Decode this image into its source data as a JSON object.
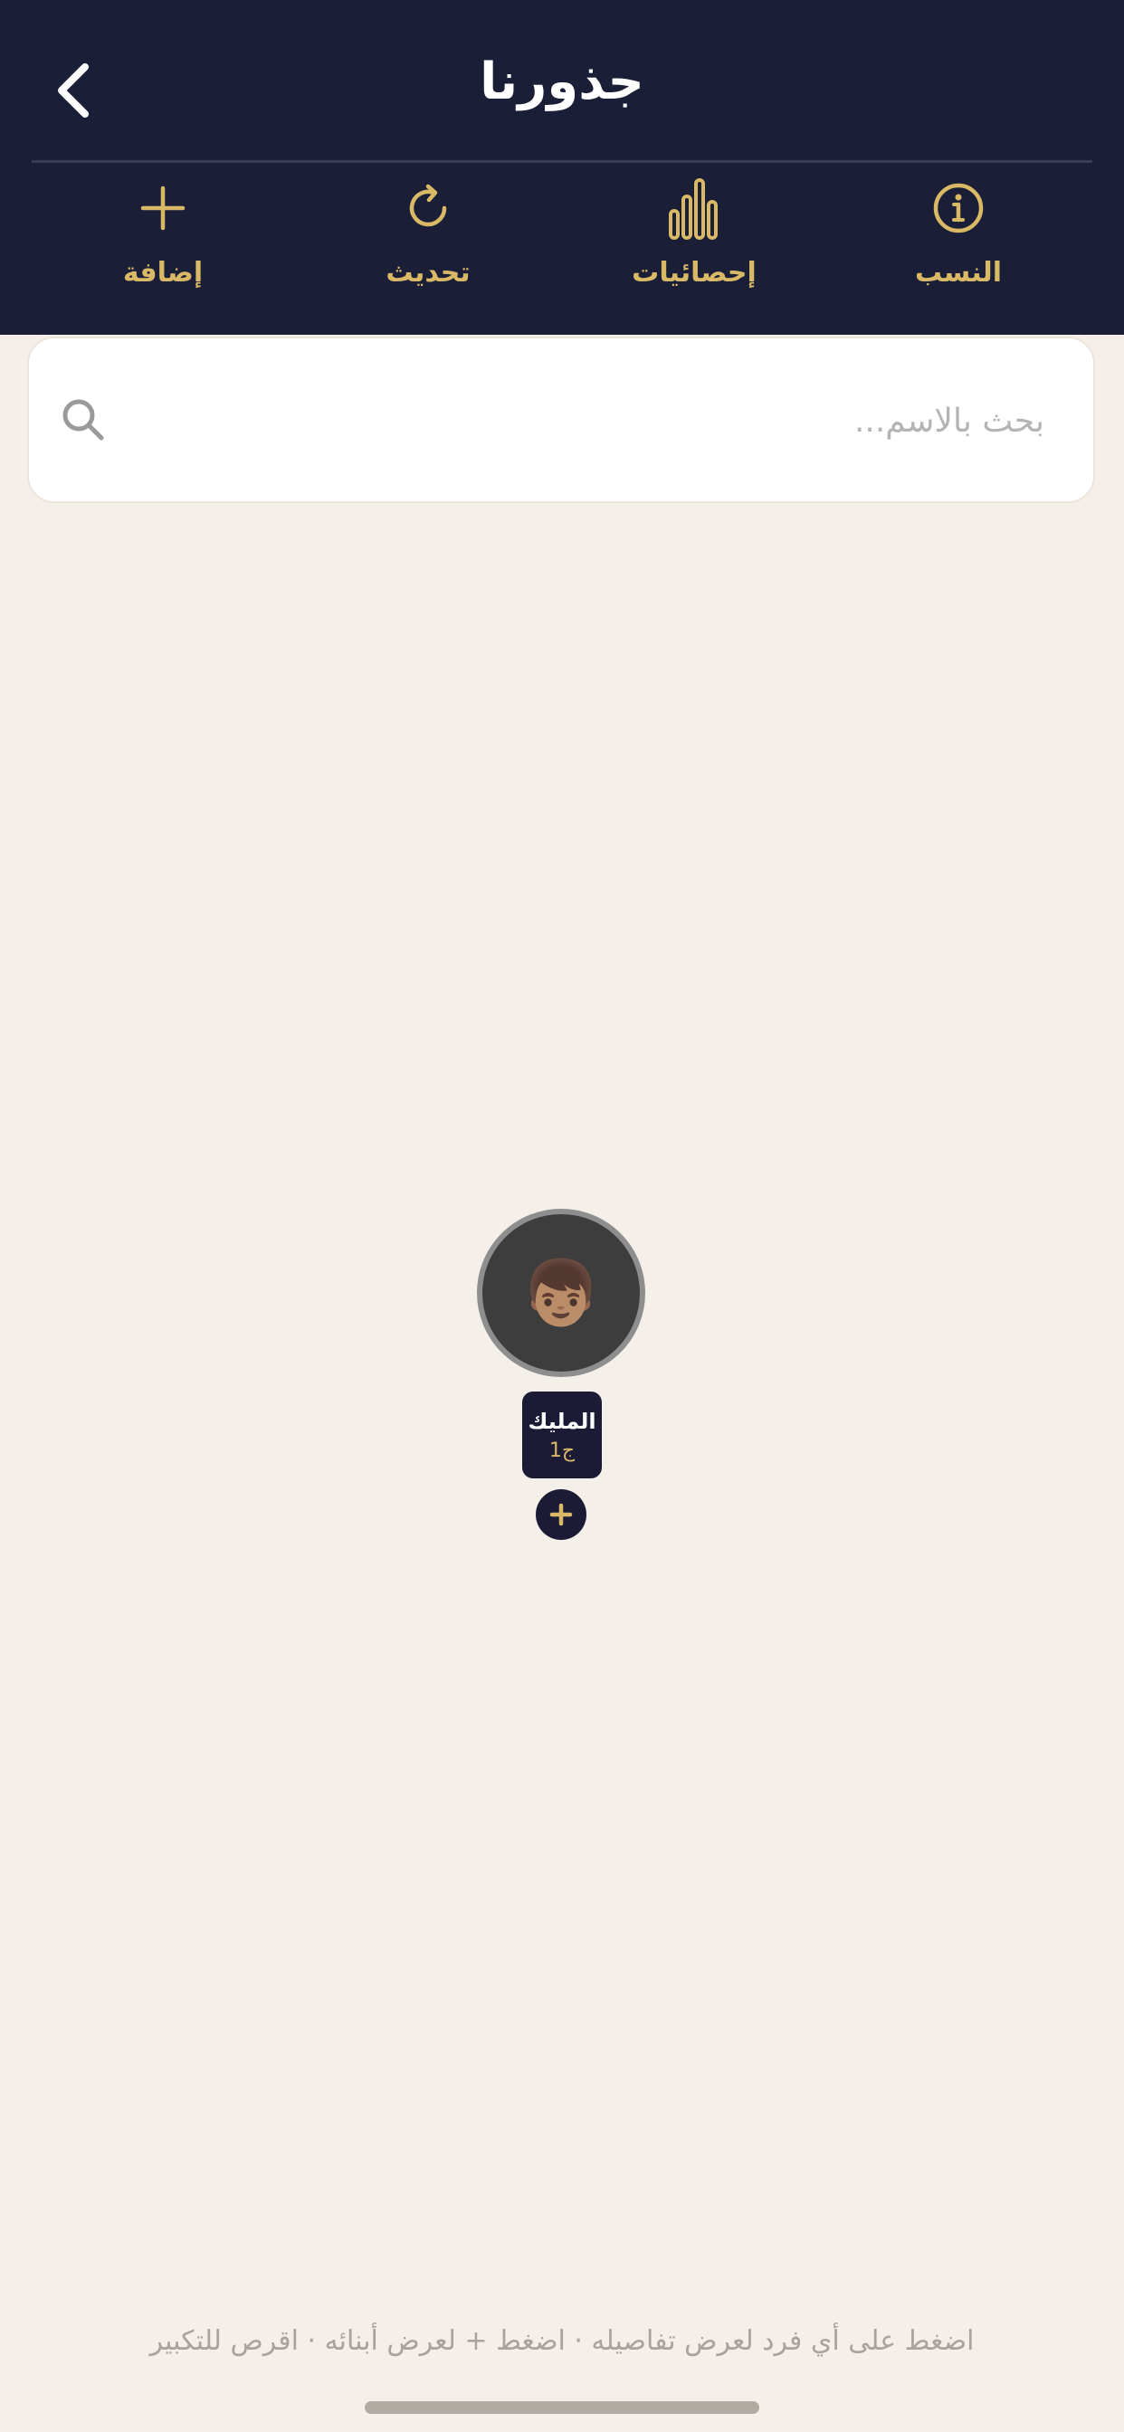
{
  "header": {
    "title": "جذورنا",
    "back_icon": "chevron-left-icon"
  },
  "toolbar": {
    "items": [
      {
        "label": "النسب",
        "icon": "info-circle-icon"
      },
      {
        "label": "إحصائيات",
        "icon": "bar-chart-icon"
      },
      {
        "label": "تحديث",
        "icon": "refresh-icon"
      },
      {
        "label": "إضافة",
        "icon": "plus-icon"
      }
    ]
  },
  "search": {
    "placeholder": "بحث بالاسم...",
    "value": ""
  },
  "tree": {
    "root": {
      "avatar": "👦🏽",
      "name": "المليك",
      "generation": "ج1"
    },
    "add_child_icon": "plus-icon"
  },
  "footer": {
    "hint": "اضغط على أي فرد لعرض تفاصيله · اضغط + لعرض أبنائه · اقرص للتكبير"
  },
  "colors": {
    "header_bg": "#1a1e36",
    "accent_gold": "#d9b866",
    "page_bg": "#f4efe8",
    "node_bg": "#1b1b36"
  }
}
